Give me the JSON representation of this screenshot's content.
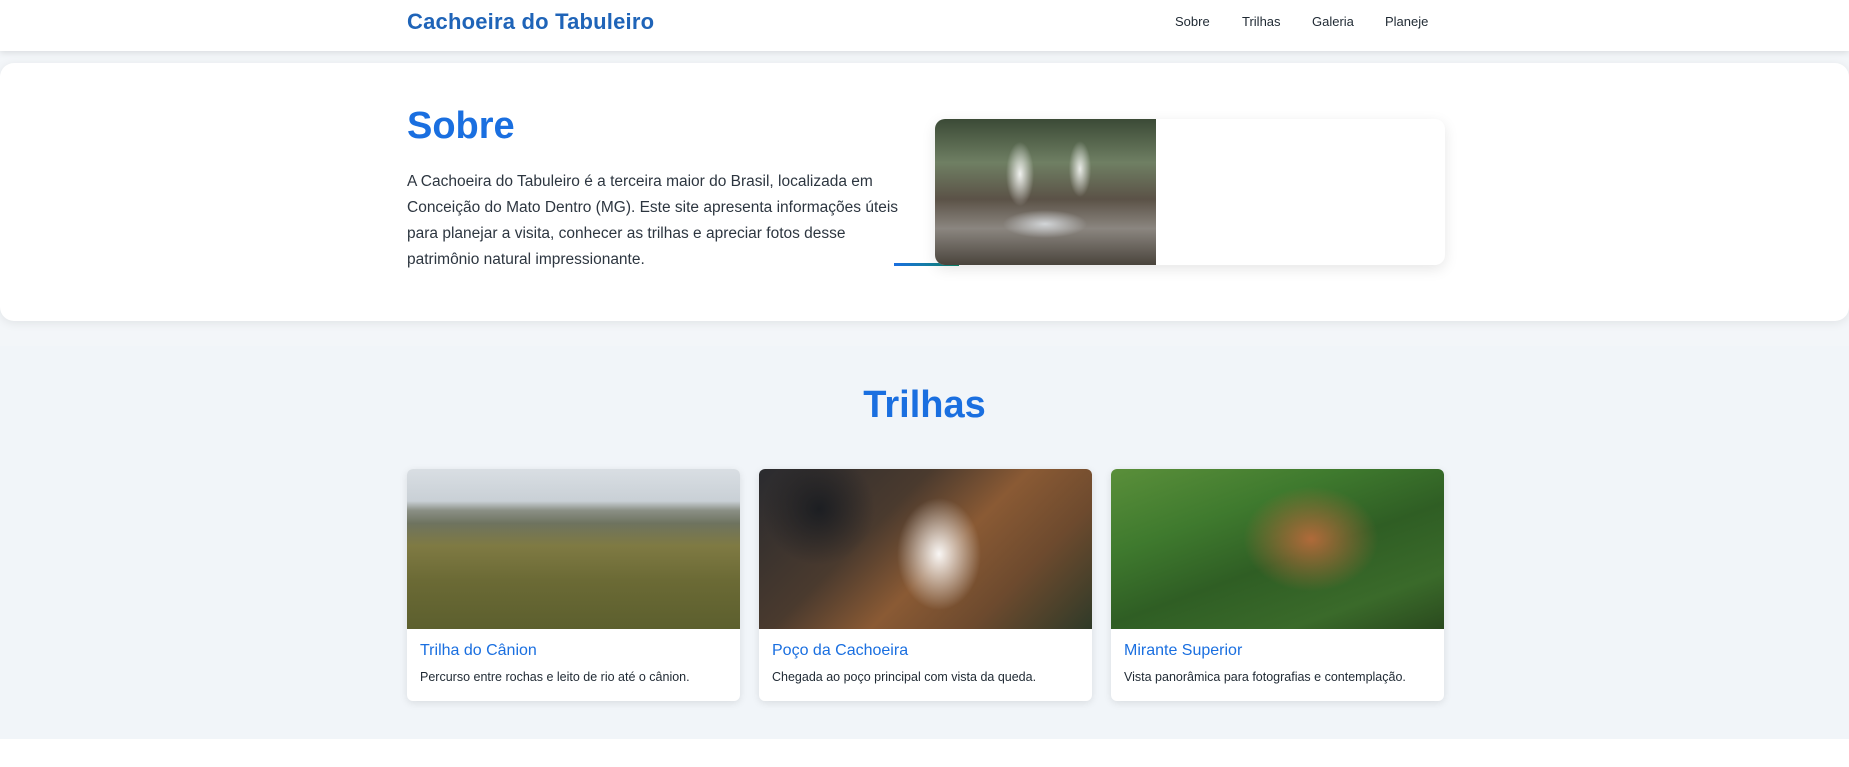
{
  "header": {
    "brand": "Cachoeira do Tabuleiro",
    "nav": [
      "Sobre",
      "Trilhas",
      "Galeria",
      "Planeje"
    ]
  },
  "about": {
    "title": "Sobre",
    "text": "A Cachoeira do Tabuleiro é a terceira maior do Brasil, localizada em Conceição do Mato Dentro (MG). Este site apresenta informações úteis para planejar a visita, conhecer as trilhas e apreciar fotos desse patrimônio natural impressionante."
  },
  "trails": {
    "title": "Trilhas",
    "cards": [
      {
        "title": "Trilha do Cânion",
        "desc": "Percurso entre rochas e leito de rio até o cânion."
      },
      {
        "title": "Poço da Cachoeira",
        "desc": "Chegada ao poço principal com vista da queda."
      },
      {
        "title": "Mirante Superior",
        "desc": "Vista panorâmica para fotografias e contemplação."
      }
    ]
  }
}
